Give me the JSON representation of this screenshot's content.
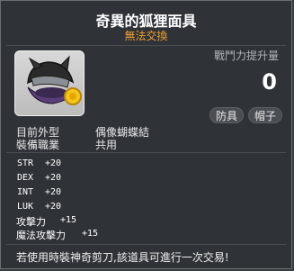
{
  "item": {
    "name": "奇異的狐狸面具",
    "trade": "無法交換"
  },
  "power": {
    "label": "戰鬥力提升量",
    "value": "0"
  },
  "tags": [
    "防具",
    "帽子"
  ],
  "info": [
    {
      "label": "目前外型",
      "value": "偶像蝴蝶結"
    },
    {
      "label": "裝備職業",
      "value": "共用"
    }
  ],
  "stats": [
    {
      "name": "STR",
      "value": "+20"
    },
    {
      "name": "DEX",
      "value": "+20"
    },
    {
      "name": "INT",
      "value": "+20"
    },
    {
      "name": "LUK",
      "value": "+20"
    }
  ],
  "attack": {
    "label": "攻擊力",
    "value": "+15"
  },
  "magic_attack": {
    "label": "魔法攻擊力",
    "value": "+15"
  },
  "notice": "若使用時裝神奇剪刀,該道具可進行一次交易!",
  "colors": {
    "trade": "#f0a030",
    "background": "#2f3337"
  },
  "icon": "fox-mask-hat-icon"
}
